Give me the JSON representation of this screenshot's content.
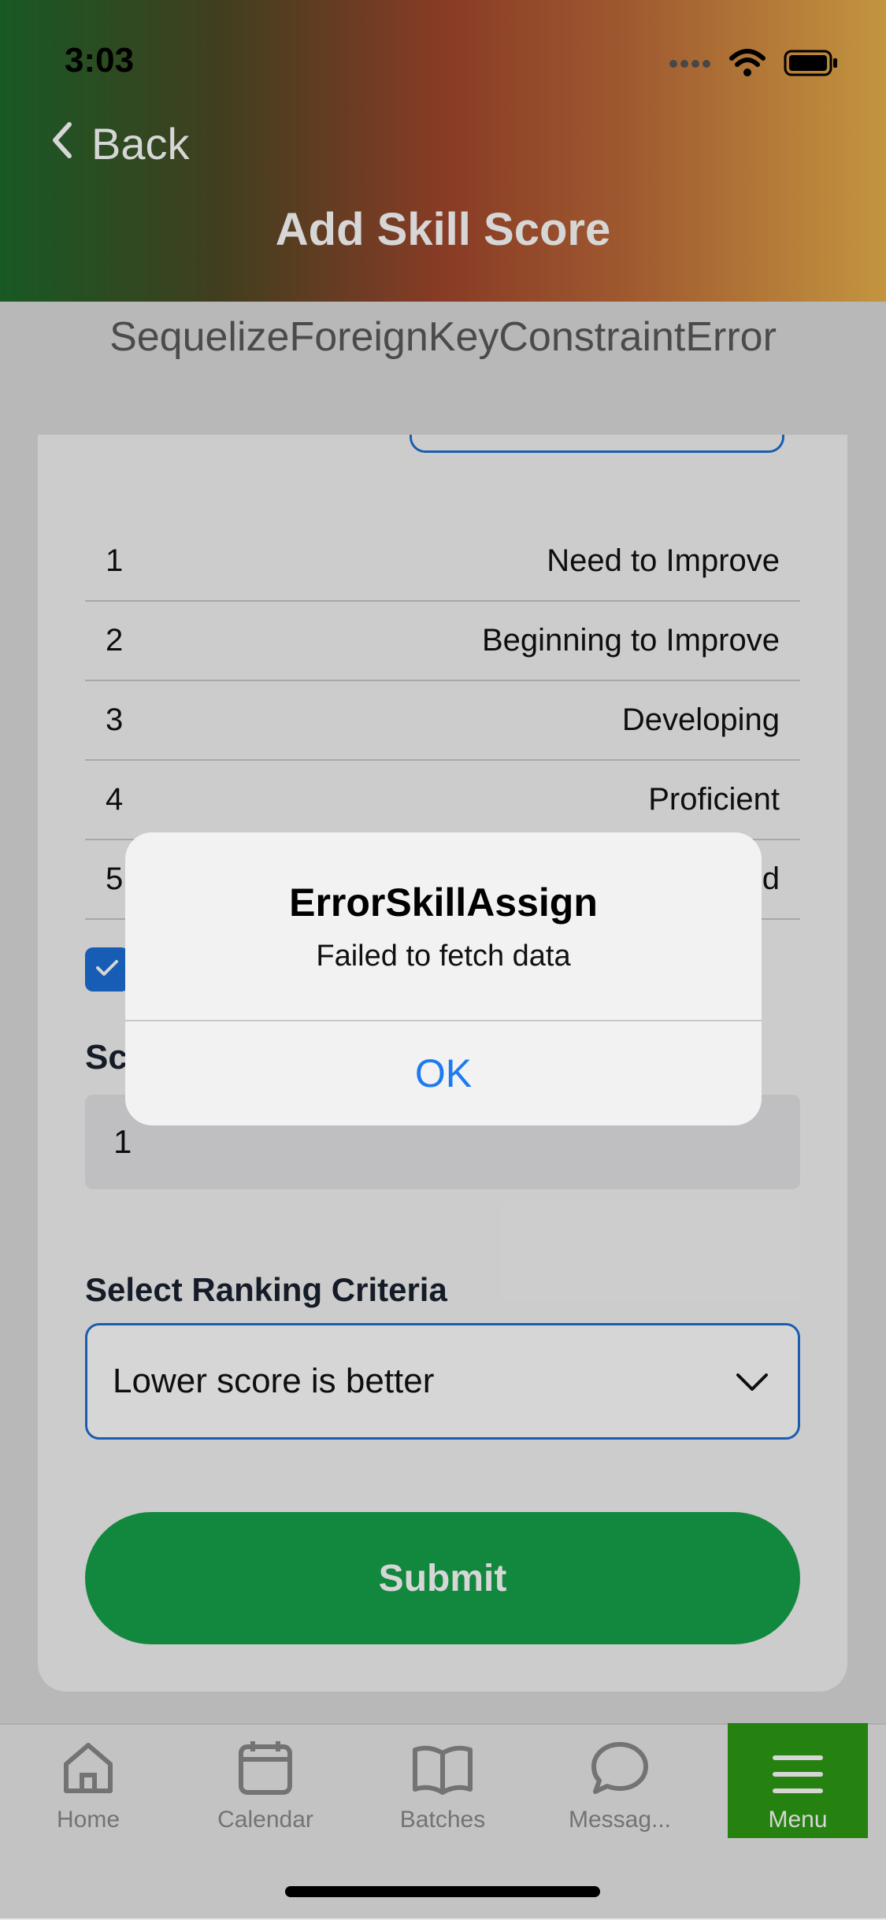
{
  "status_bar": {
    "time": "3:03"
  },
  "nav": {
    "back_label": "Back",
    "title": "Add Skill Score"
  },
  "error_text": "SequelizeForeignKeyConstraintError",
  "score_table": [
    {
      "score": "1",
      "description": "Need to Improve"
    },
    {
      "score": "2",
      "description": "Beginning to Improve"
    },
    {
      "score": "3",
      "description": "Developing"
    },
    {
      "score": "4",
      "description": "Proficient"
    },
    {
      "score": "5",
      "description": "d"
    }
  ],
  "score_field": {
    "label": "Sc",
    "value": "1"
  },
  "ranking": {
    "label": "Select Ranking Criteria",
    "selected": "Lower score is better"
  },
  "submit_label": "Submit",
  "tabs": [
    {
      "label": "Home",
      "icon": "home-icon"
    },
    {
      "label": "Calendar",
      "icon": "calendar-icon"
    },
    {
      "label": "Batches",
      "icon": "book-icon"
    },
    {
      "label": "Messag...",
      "icon": "chat-bubble-icon"
    },
    {
      "label": "Menu",
      "icon": "menu-icon"
    }
  ],
  "alert": {
    "title": "ErrorSkillAssign",
    "message": "Failed to fetch data",
    "ok_label": "OK"
  },
  "colors": {
    "accent": "#1d7af2",
    "submit": "#16a24a",
    "menu_tab": "#2d9a14"
  }
}
